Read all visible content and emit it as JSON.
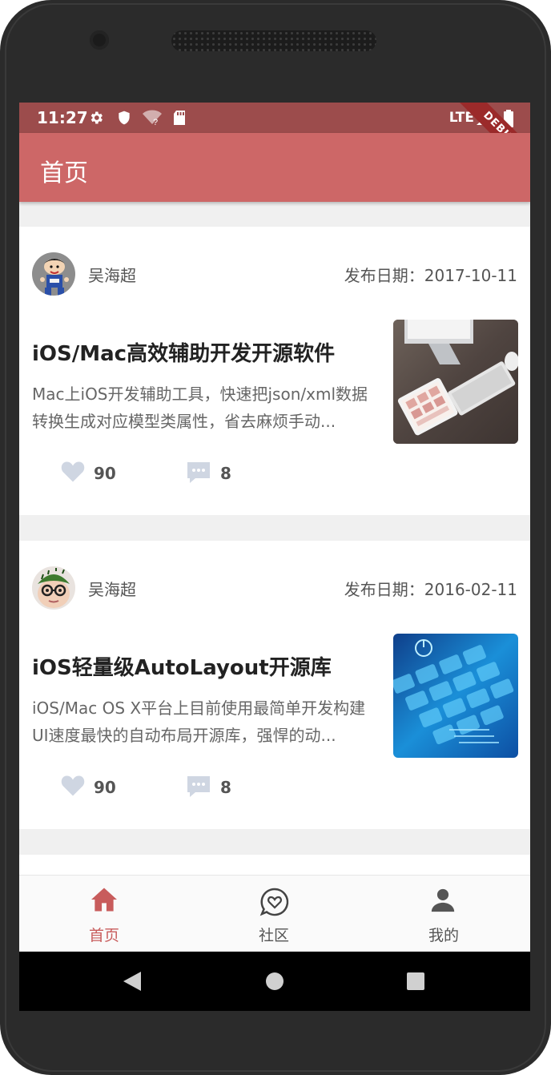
{
  "status_bar": {
    "time": "11:27",
    "network": "LTE",
    "debug_banner": "DEBUG",
    "icons": [
      "gear-icon",
      "shield-icon",
      "wifi-unknown-icon",
      "sd-card-icon",
      "signal-icon",
      "battery-icon"
    ]
  },
  "app_bar": {
    "title": "首页"
  },
  "articles": [
    {
      "author": "吴海超",
      "date": "发布日期：2017-10-11",
      "title": "iOS/Mac高效辅助开发开源软件",
      "summary": "Mac上iOS开发辅助工具，快速把json/xml数据转换生成对应模型类属性，省去麻烦手动...",
      "likes": "90",
      "comments": "8",
      "avatar": "cartoon-boy-avatar",
      "thumbnail": "tablet-keyboard-photo"
    },
    {
      "author": "吴海超",
      "date": "发布日期：2016-02-11",
      "title": "iOS轻量级AutoLayout开源库",
      "summary": "iOS/Mac OS X平台上目前使用最简单开发构建UI速度最快的自动布局开源库，强悍的动...",
      "likes": "90",
      "comments": "8",
      "avatar": "watermelon-baby-avatar",
      "thumbnail": "blue-keyboard-photo"
    }
  ],
  "bottom_nav": [
    {
      "label": "首页",
      "icon": "home-icon",
      "active": true
    },
    {
      "label": "社区",
      "icon": "chat-heart-icon",
      "active": false
    },
    {
      "label": "我的",
      "icon": "person-icon",
      "active": false
    }
  ],
  "colors": {
    "status_bar": "#9c4c4c",
    "app_bar": "#cd6767",
    "active_nav": "#c85c5c",
    "inactive_nav": "#555555",
    "action_icon": "#cfd6e2"
  }
}
